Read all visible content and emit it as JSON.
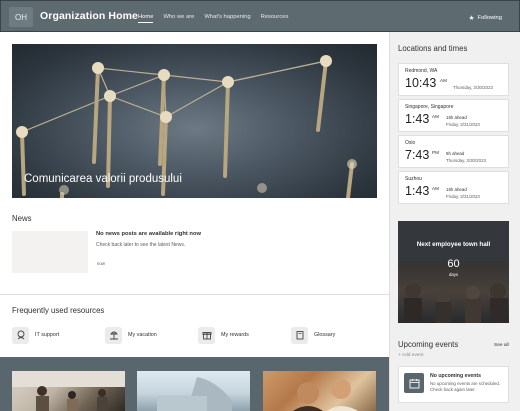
{
  "header": {
    "logo_text": "OH",
    "title": "Organization Home",
    "nav": [
      {
        "label": "Home",
        "active": true
      },
      {
        "label": "Who we are",
        "active": false
      },
      {
        "label": "What's happening",
        "active": false
      },
      {
        "label": "Resources",
        "active": false
      }
    ],
    "follow_label": "Following",
    "follow_icon": "star-icon"
  },
  "hero": {
    "title": "Comunicarea valorii produsului"
  },
  "news": {
    "title": "News",
    "empty_heading": "No news posts are available right now",
    "empty_sub": "Check back later to see the latest News.",
    "now": "now"
  },
  "resources": {
    "title": "Frequently used resources",
    "items": [
      {
        "label": "IT support",
        "icon": "support-icon"
      },
      {
        "label": "My vacation",
        "icon": "vacation-icon"
      },
      {
        "label": "My rewards",
        "icon": "gift-icon"
      },
      {
        "label": "Glossary",
        "icon": "book-icon"
      }
    ]
  },
  "locations": {
    "title": "Locations and times",
    "items": [
      {
        "city": "Redmond, WA",
        "time": "10:43",
        "ampm": "AM",
        "ahead": "",
        "date": "Thursday, 3/30/2023"
      },
      {
        "city": "Singapore, Singapore",
        "time": "1:43",
        "ampm": "AM",
        "ahead": "15h ahead",
        "date": "Friday, 3/31/2023"
      },
      {
        "city": "Oslo",
        "time": "7:43",
        "ampm": "PM",
        "ahead": "9h ahead",
        "date": "Thursday, 3/30/2023"
      },
      {
        "city": "Suzhou",
        "time": "1:43",
        "ampm": "AM",
        "ahead": "15h ahead",
        "date": "Friday, 3/31/2023"
      }
    ]
  },
  "townhall": {
    "label": "Next employee town hall",
    "number": "60",
    "unit": "days"
  },
  "events": {
    "title": "Upcoming events",
    "see_all": "See all",
    "add_event": "+ Add event",
    "empty_heading": "No upcoming events",
    "empty_sub": "No upcoming events are scheduled. Check back again later."
  },
  "colors": {
    "header_bg": "#5d6a70",
    "rail_bg": "#f0f0f0",
    "band_bg": "#5a666d"
  }
}
